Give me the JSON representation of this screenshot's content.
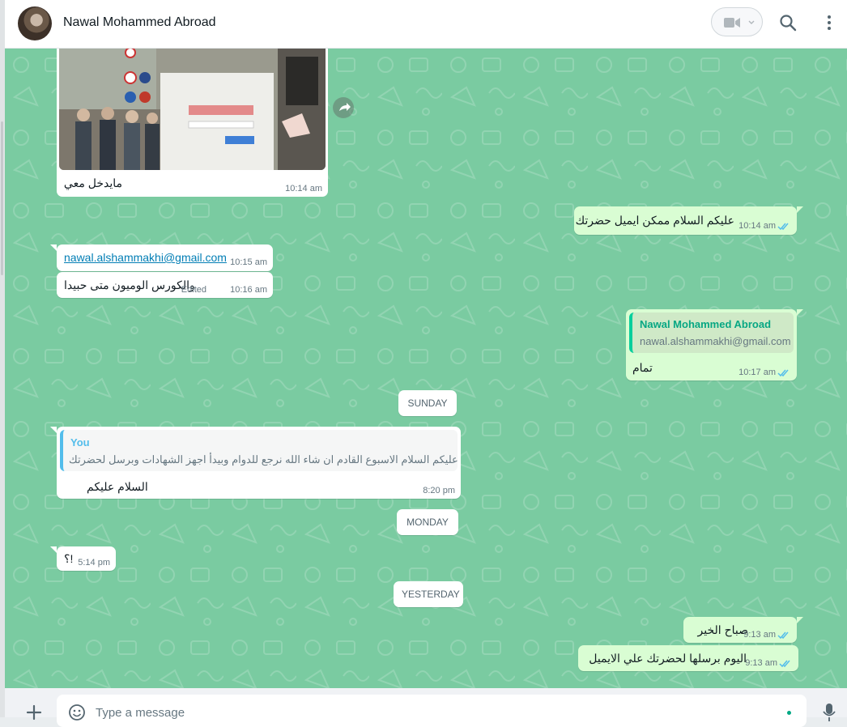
{
  "header": {
    "contact_name": "Nawal Mohammed Abroad"
  },
  "messages": {
    "image_msg": {
      "caption": "مايدخل معي",
      "time": "10:14 am"
    },
    "out_email_request": {
      "text": "عليكم السلام ممكن ايميل حضرتك",
      "time": "10:14 am"
    },
    "email_msg": {
      "text": "nawal.alshammakhi@gmail.com",
      "time": "10:15 am"
    },
    "course_msg": {
      "text": "والكورس الوميون متى حبيدا",
      "edited": "Edited",
      "time": "10:16 am"
    },
    "out_ok": {
      "quote_name": "Nawal Mohammed Abroad",
      "quote_text": "nawal.alshammakhi@gmail.com",
      "text": "تمام",
      "time": "10:17 am"
    },
    "day_sunday": "SUNDAY",
    "reply_msg": {
      "quote_name": "You",
      "quote_text": "عليكم السلام الاسبوع القادم ان شاء الله نرجع للدوام وبيدأ اجهز الشهادات وبرسل لحضرتك",
      "text": "السلام عليكم",
      "time": "8:20 pm"
    },
    "day_monday": "MONDAY",
    "question_msg": {
      "text": "؟!",
      "time": "5:14 pm"
    },
    "day_yesterday": "YESTERDAY",
    "out_morning": {
      "text": "صباح الخير",
      "time": "9:13 am"
    },
    "out_today": {
      "text": "اليوم برسلها لحضرتك علي الايميل",
      "time": "9:13 am"
    }
  },
  "composer": {
    "placeholder": "Type a message"
  },
  "colors": {
    "chat_bg": "#7acba1",
    "out_bubble": "#d9fdd3",
    "in_bubble": "#ffffff",
    "accent": "#00a884",
    "read_ticks": "#53bdeb"
  },
  "icons": [
    "video-camera-icon",
    "chevron-down-icon",
    "search-icon",
    "menu-icon",
    "forward-icon",
    "plus-icon",
    "emoji-icon",
    "mic-icon",
    "double-check-icon"
  ]
}
